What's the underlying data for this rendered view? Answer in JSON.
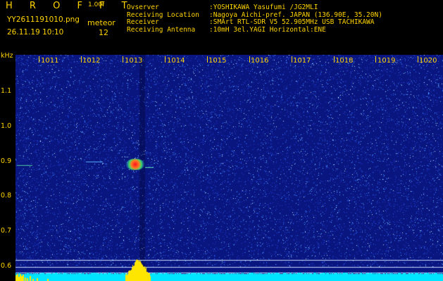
{
  "header": {
    "logo": "H R O F F T",
    "version": "1.00f",
    "filename": "YY2611191010.png",
    "meteor_label": "meteor",
    "datetime": "26.11.19 10:10",
    "meteor_count": "12",
    "info": [
      {
        "label": "Ovserver",
        "value": ":YOSHIKAWA Yasufumi /JG2MLI"
      },
      {
        "label": "Receiving Location",
        "value": ":Nagoya Aichi-pref. JAPAN (136.90E, 35.20N)"
      },
      {
        "label": "Receiver",
        "value": ":SMArt RTL-SDR V5 52.905MHz USB TACHIKAWA"
      },
      {
        "label": "Receiving Antenna",
        "value": ":10mH 3el.YAGI Horizontal:ENE"
      }
    ]
  },
  "axis": {
    "y_unit": "kHz",
    "y_ticks": [
      "1.1",
      "1.0",
      "0.9",
      "0.8",
      "0.7",
      "0.6"
    ],
    "x_ticks": [
      "1011",
      "1012",
      "1013",
      "1014",
      "1015",
      "1016",
      "1017",
      "1018",
      "1019",
      "1020"
    ]
  },
  "colors": {
    "text": "#ffd400",
    "background": "#0a1680",
    "signal_level": "#00e5ff",
    "bursts": "#ffe600"
  }
}
